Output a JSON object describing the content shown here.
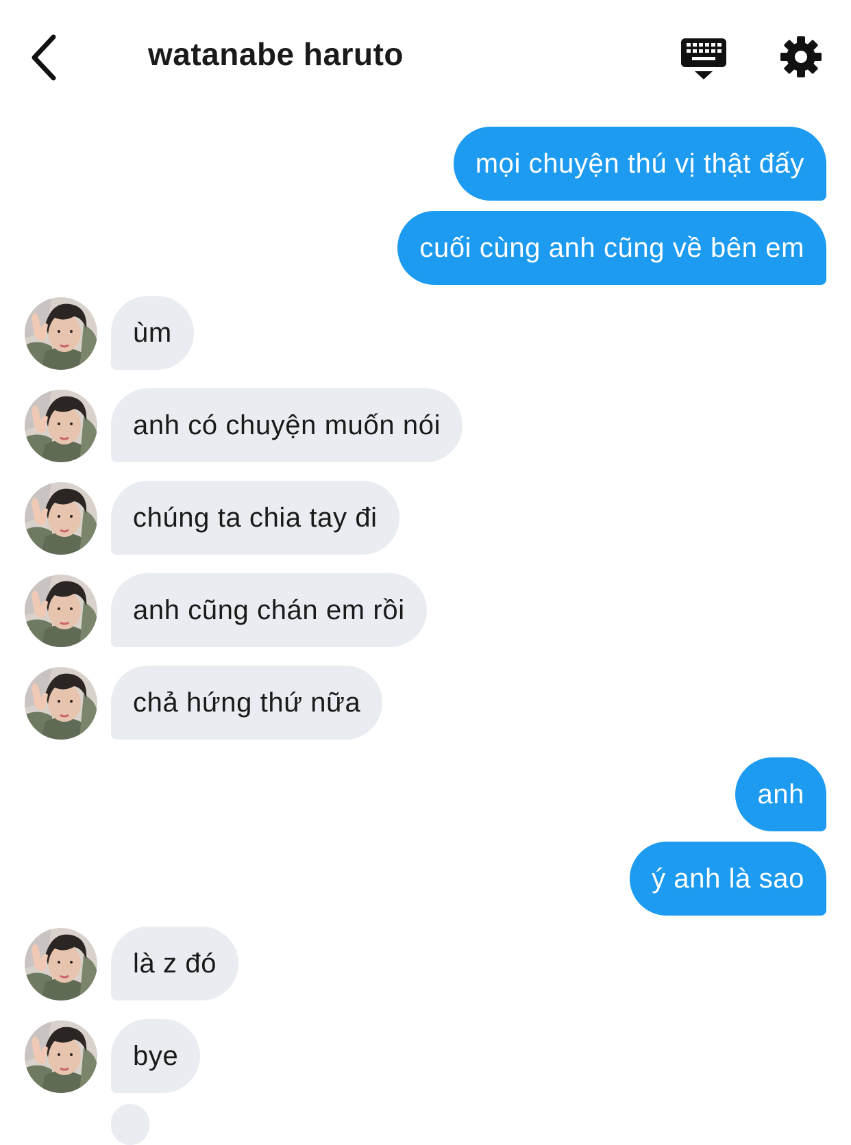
{
  "header": {
    "title": "watanabe haruto",
    "back_icon": "chevron-left-icon",
    "keyboard_icon": "keyboard-icon",
    "settings_icon": "gear-icon"
  },
  "colors": {
    "outgoing_bubble": "#1d9bf0",
    "incoming_bubble": "#e9ecf0",
    "text_dark": "#1a1a1a"
  },
  "messages": [
    {
      "direction": "out",
      "text": "mọi chuyện thú vị thật đấy"
    },
    {
      "direction": "out",
      "text": "cuối cùng anh cũng về bên em"
    },
    {
      "direction": "in",
      "text": "ùm"
    },
    {
      "direction": "in",
      "text": "anh có chuyện muốn nói"
    },
    {
      "direction": "in",
      "text": "chúng ta chia tay đi"
    },
    {
      "direction": "in",
      "text": "anh cũng chán em rồi"
    },
    {
      "direction": "in",
      "text": "chả hứng thứ nữa"
    },
    {
      "direction": "out",
      "text": "anh"
    },
    {
      "direction": "out",
      "text": "ý anh là sao"
    },
    {
      "direction": "in",
      "text": "là z đó"
    },
    {
      "direction": "in",
      "text": "bye"
    }
  ]
}
